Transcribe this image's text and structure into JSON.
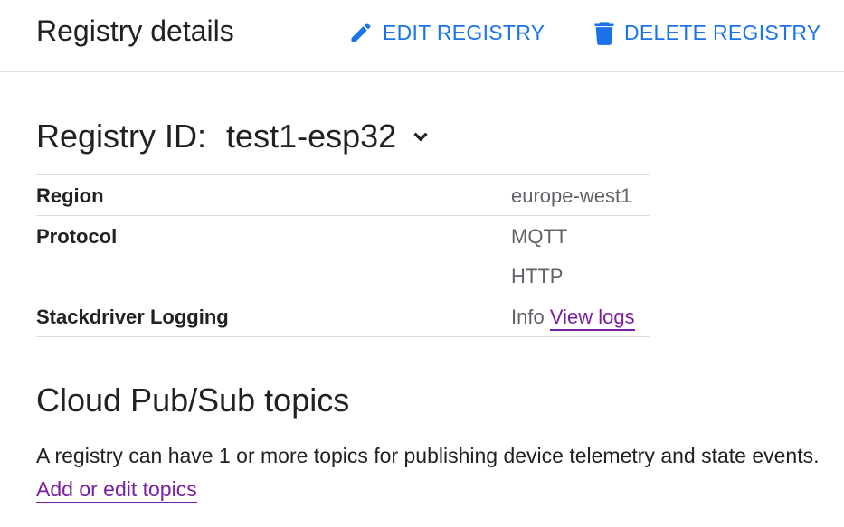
{
  "header": {
    "title": "Registry details",
    "edit_label": "EDIT REGISTRY",
    "delete_label": "DELETE REGISTRY",
    "edit_icon": "pencil-icon",
    "delete_icon": "trash-icon"
  },
  "registry": {
    "id_label": "Registry ID:",
    "id_value": "test1-esp32",
    "chevron_icon": "chevron-down-icon"
  },
  "details": {
    "region_label": "Region",
    "region_value": "europe-west1",
    "protocol_label": "Protocol",
    "protocols": [
      "MQTT",
      "HTTP"
    ],
    "logging_label": "Stackdriver Logging",
    "logging_level": "Info",
    "logging_link": "View logs"
  },
  "pubsub": {
    "title": "Cloud Pub/Sub topics",
    "description": "A registry can have 1 or more topics for publishing device telemetry and state events.",
    "link": "Add or edit topics"
  },
  "colors": {
    "accent": "#1a73e8",
    "link": "#7b1fa2",
    "text": "#202124",
    "muted": "#5f6368",
    "divider": "#dadce0"
  }
}
